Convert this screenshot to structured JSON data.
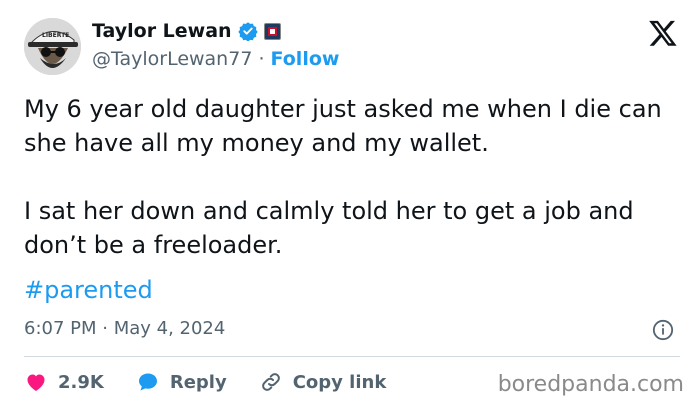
{
  "author": {
    "name": "Taylor Lewan",
    "handle": "@TaylorLewan77",
    "separator": "·",
    "follow_label": "Follow",
    "avatar_cap_text": "LIBERTE",
    "verified_color": "#1d9bf0"
  },
  "tweet": {
    "paragraph1": "My 6 year old daughter just asked me when I die can she have all my money and my wallet.",
    "paragraph2": "I sat her down and calmly told her to get a job and don’t be a freeloader.",
    "hashtag": "#parented",
    "timestamp": "6:07 PM · May 4, 2024"
  },
  "actions": {
    "likes": "2.9K",
    "reply_label": "Reply",
    "copy_link_label": "Copy link"
  },
  "watermark": "boredpanda.com",
  "colors": {
    "accent": "#1d9bf0",
    "heart": "#f91880",
    "muted": "#536471"
  },
  "icons": [
    "x-logo-icon",
    "verified-badge-icon",
    "affiliate-badge-icon",
    "info-icon",
    "heart-icon",
    "reply-bubble-icon",
    "link-icon"
  ]
}
